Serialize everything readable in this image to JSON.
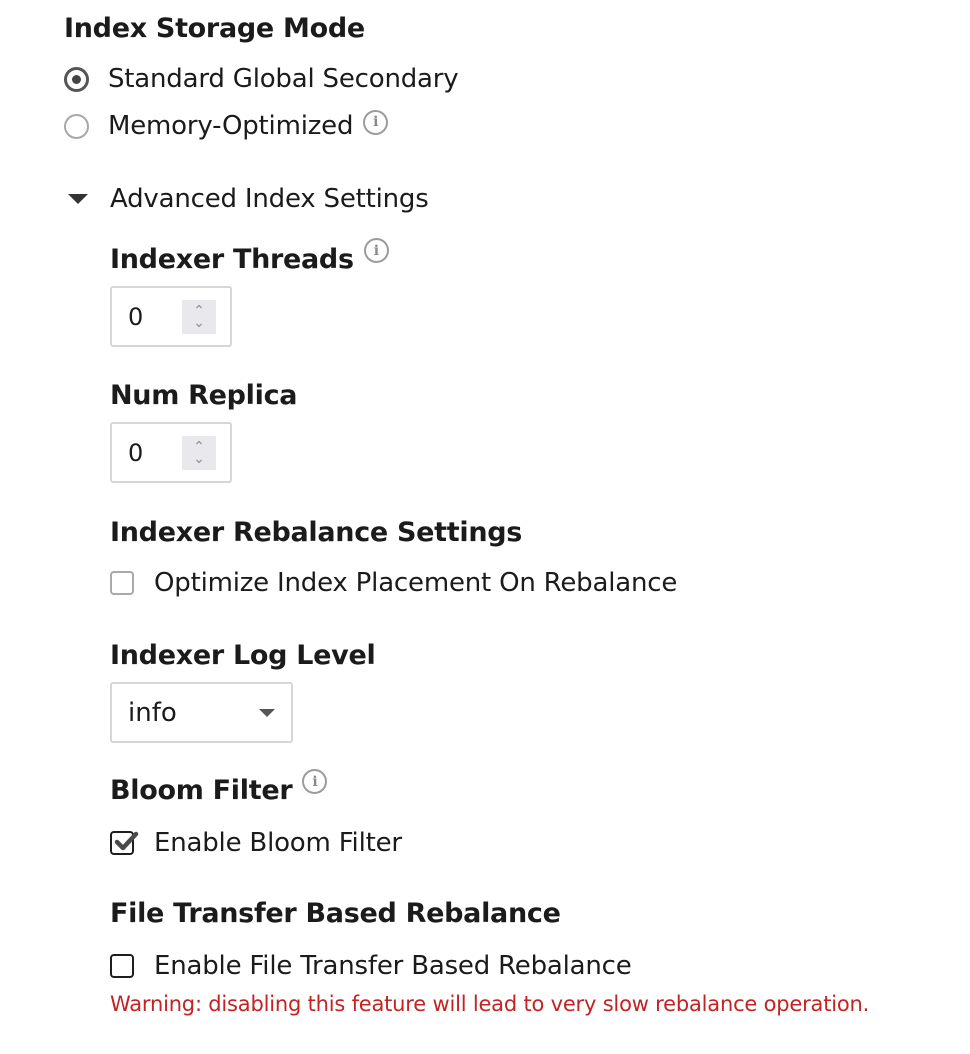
{
  "storage_mode": {
    "title": "Index Storage Mode",
    "options": [
      {
        "label": "Standard Global Secondary",
        "selected": true
      },
      {
        "label": "Memory-Optimized",
        "selected": false,
        "has_info": true
      }
    ]
  },
  "advanced": {
    "toggle_label": "Advanced Index Settings",
    "expanded": true,
    "indexer_threads": {
      "label": "Indexer Threads",
      "value": "0",
      "has_info": true
    },
    "num_replica": {
      "label": "Num Replica",
      "value": "0"
    },
    "rebalance": {
      "title": "Indexer Rebalance Settings",
      "checkbox_label": "Optimize Index Placement On Rebalance",
      "checked": false,
      "disabled": true
    },
    "log_level": {
      "label": "Indexer Log Level",
      "selected": "info"
    },
    "bloom_filter": {
      "title": "Bloom Filter",
      "checkbox_label": "Enable Bloom Filter",
      "checked": true,
      "has_info": true
    },
    "file_transfer": {
      "title": "File Transfer Based Rebalance",
      "checkbox_label": "Enable File Transfer Based Rebalance",
      "checked": false,
      "warning": "Warning: disabling this feature will lead to very slow rebalance operation."
    }
  },
  "icons": {
    "info": "i",
    "spin_up": "^",
    "spin_down": "v"
  },
  "colors": {
    "warning": "#c32323",
    "text": "#1b1b1b",
    "border": "#d6d6d6"
  }
}
